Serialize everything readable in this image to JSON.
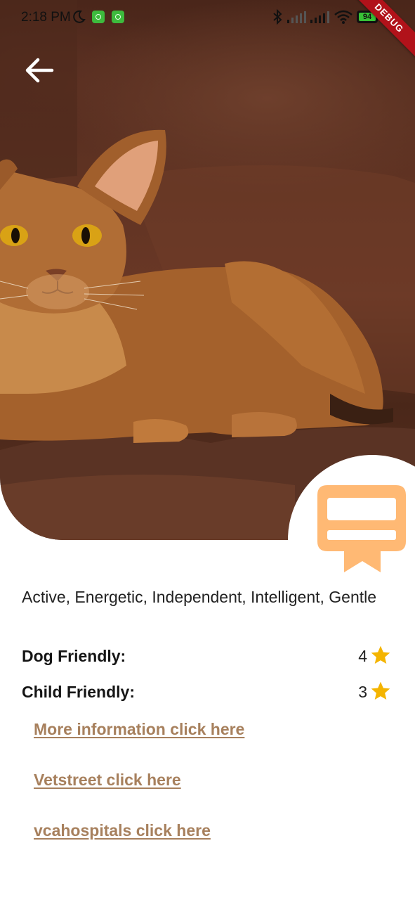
{
  "status_bar": {
    "time": "2:18 PM",
    "battery": "94",
    "battery_level": 0.94,
    "debug_label": "DEBUG"
  },
  "hero": {
    "image_subject": "cat"
  },
  "details": {
    "temperament": "Active, Energetic, Independent, Intelligent, Gentle",
    "ratings": [
      {
        "label": "Dog Friendly:",
        "value": "4"
      },
      {
        "label": "Child Friendly:",
        "value": "3"
      }
    ]
  },
  "links": [
    {
      "label": "More information click here"
    },
    {
      "label": "Vetstreet click here"
    },
    {
      "label": "vcahospitals click here"
    }
  ],
  "colors": {
    "accent": "#FFB974",
    "link": "#A7805D",
    "star": "#F4B400",
    "debug_ribbon": "#B1121A"
  },
  "icons": [
    "back-arrow-icon",
    "badge-icon",
    "star-icon",
    "bluetooth-icon",
    "wifi-icon",
    "signal-icon",
    "moon-icon",
    "battery-icon"
  ]
}
